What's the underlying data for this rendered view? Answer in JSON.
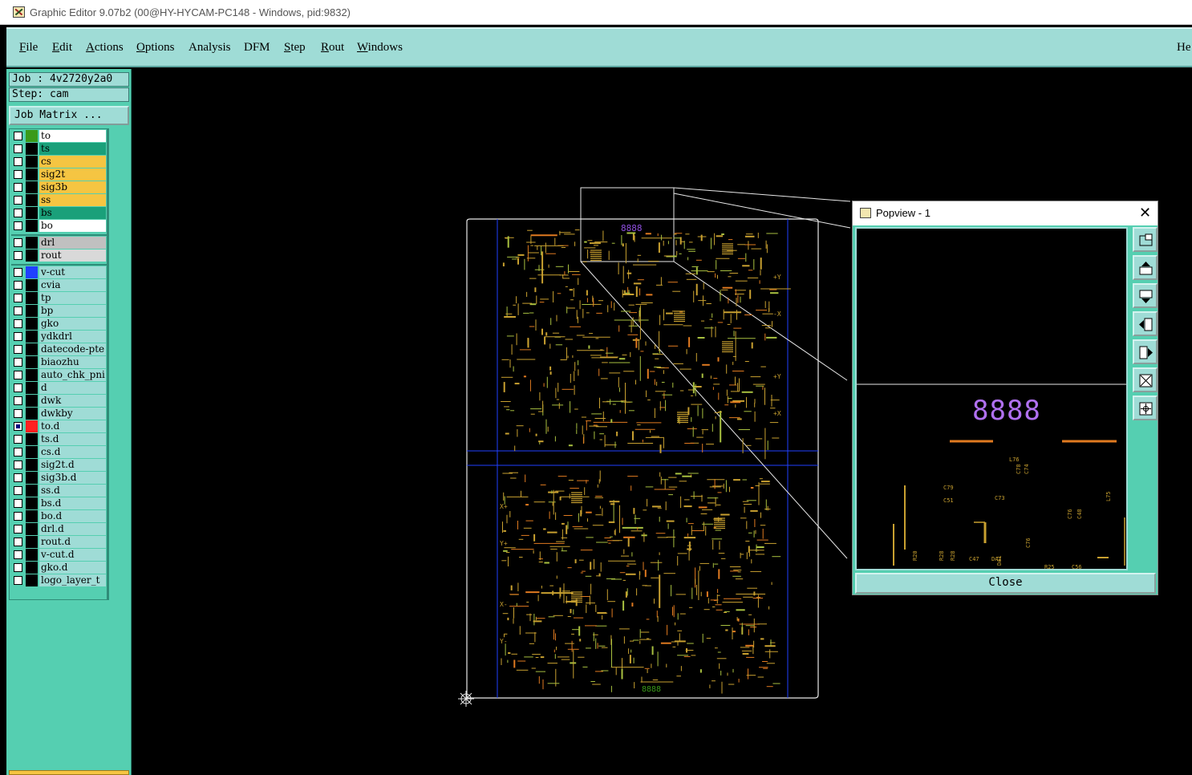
{
  "window": {
    "title": "Graphic Editor 9.07b2 (00@HY-HYCAM-PC148 - Windows, pid:9832)"
  },
  "menubar": {
    "items": [
      {
        "u": "F",
        "rest": "ile"
      },
      {
        "u": "E",
        "rest": "dit"
      },
      {
        "u": "A",
        "rest": "ctions"
      },
      {
        "u": "O",
        "rest": "ptions"
      },
      {
        "u": "",
        "rest": "Analysis"
      },
      {
        "u": "",
        "rest": "DFM"
      },
      {
        "u": "S",
        "rest": "tep"
      },
      {
        "u": "R",
        "rest": "out"
      },
      {
        "u": "W",
        "rest": "indows"
      }
    ],
    "help": "He"
  },
  "panel": {
    "job": "Job : 4v2720y2a0",
    "step": "Step: cam",
    "job_matrix": "Job Matrix ..."
  },
  "layers": [
    {
      "name": "to",
      "fill": "#ffffff",
      "swatch": "#3a9a1a",
      "checked": false
    },
    {
      "name": "ts",
      "fill": "#1aa07a",
      "swatch": "#000000",
      "checked": false
    },
    {
      "name": "cs",
      "fill": "#f5c542",
      "swatch": "#000000",
      "checked": false
    },
    {
      "name": "sig2t",
      "fill": "#f5c542",
      "swatch": "#000000",
      "checked": false
    },
    {
      "name": "sig3b",
      "fill": "#f5c542",
      "swatch": "#000000",
      "checked": false
    },
    {
      "name": "ss",
      "fill": "#f5c542",
      "swatch": "#000000",
      "checked": false
    },
    {
      "name": "bs",
      "fill": "#1aa07a",
      "swatch": "#000000",
      "checked": false
    },
    {
      "name": "bo",
      "fill": "#ffffff",
      "swatch": "#000000",
      "checked": false
    },
    {
      "name": "drl",
      "fill": "#c0c0c0",
      "swatch": "#000000",
      "checked": false
    },
    {
      "name": "rout",
      "fill": "#d9d9d9",
      "swatch": "#000000",
      "checked": false
    },
    {
      "name": "v-cut",
      "fill": "#9fdcd6",
      "swatch": "#2040ff",
      "checked": false
    },
    {
      "name": "cvia",
      "fill": "#9fdcd6",
      "swatch": "#000000",
      "checked": false
    },
    {
      "name": "tp",
      "fill": "#9fdcd6",
      "swatch": "#000000",
      "checked": false
    },
    {
      "name": "bp",
      "fill": "#9fdcd6",
      "swatch": "#000000",
      "checked": false
    },
    {
      "name": "gko",
      "fill": "#9fdcd6",
      "swatch": "#000000",
      "checked": false
    },
    {
      "name": "ydkdrl",
      "fill": "#9fdcd6",
      "swatch": "#000000",
      "checked": false
    },
    {
      "name": "datecode-pte",
      "fill": "#9fdcd6",
      "swatch": "#000000",
      "checked": false
    },
    {
      "name": "biaozhu",
      "fill": "#9fdcd6",
      "swatch": "#000000",
      "checked": false
    },
    {
      "name": "auto_chk_pni",
      "fill": "#9fdcd6",
      "swatch": "#000000",
      "checked": false
    },
    {
      "name": "d",
      "fill": "#9fdcd6",
      "swatch": "#000000",
      "checked": false
    },
    {
      "name": "dwk",
      "fill": "#9fdcd6",
      "swatch": "#000000",
      "checked": false
    },
    {
      "name": "dwkby",
      "fill": "#9fdcd6",
      "swatch": "#000000",
      "checked": false
    },
    {
      "name": "to.d",
      "fill": "#9fdcd6",
      "swatch": "#ff2020",
      "checked": true
    },
    {
      "name": "ts.d",
      "fill": "#9fdcd6",
      "swatch": "#000000",
      "checked": false
    },
    {
      "name": "cs.d",
      "fill": "#9fdcd6",
      "swatch": "#000000",
      "checked": false
    },
    {
      "name": "sig2t.d",
      "fill": "#9fdcd6",
      "swatch": "#000000",
      "checked": false
    },
    {
      "name": "sig3b.d",
      "fill": "#9fdcd6",
      "swatch": "#000000",
      "checked": false
    },
    {
      "name": "ss.d",
      "fill": "#9fdcd6",
      "swatch": "#000000",
      "checked": false
    },
    {
      "name": "bs.d",
      "fill": "#9fdcd6",
      "swatch": "#000000",
      "checked": false
    },
    {
      "name": "bo.d",
      "fill": "#9fdcd6",
      "swatch": "#000000",
      "checked": false
    },
    {
      "name": "drl.d",
      "fill": "#9fdcd6",
      "swatch": "#000000",
      "checked": false
    },
    {
      "name": "rout.d",
      "fill": "#9fdcd6",
      "swatch": "#000000",
      "checked": false
    },
    {
      "name": "v-cut.d",
      "fill": "#9fdcd6",
      "swatch": "#000000",
      "checked": false
    },
    {
      "name": "gko.d",
      "fill": "#9fdcd6",
      "swatch": "#000000",
      "checked": false
    },
    {
      "name": "logo_layer_t",
      "fill": "#9fdcd6",
      "swatch": "#000000",
      "checked": false
    }
  ],
  "board": {
    "top_marker": "8888",
    "bottom_marker": "8888",
    "edge_labels": [
      "+Y",
      "-X",
      "+Y",
      "+X",
      "X+",
      "Y+",
      "X-",
      "Y-"
    ]
  },
  "popview": {
    "title": "Popview - 1",
    "close_x": "✕",
    "close_button": "Close",
    "marker": "8888",
    "labels": [
      "C78",
      "C74",
      "C79",
      "C51",
      "C73",
      "C76",
      "C48",
      "C76",
      "R20",
      "R28",
      "R28",
      "C47",
      "DA1",
      "DA1",
      "R25",
      "C56",
      "L75",
      "L76"
    ],
    "tools": [
      "zoom-window-icon",
      "pan-up-icon",
      "pan-down-icon",
      "pan-left-icon",
      "pan-right-icon",
      "zoom-fit-icon",
      "zoom-home-icon"
    ]
  },
  "colors": {
    "trace": "#c8a030",
    "pad": "#e07a20",
    "silk": "#9050e0",
    "vcut": "#2040ff",
    "panel": "#55cfb1",
    "menu": "#9fdcd6"
  }
}
